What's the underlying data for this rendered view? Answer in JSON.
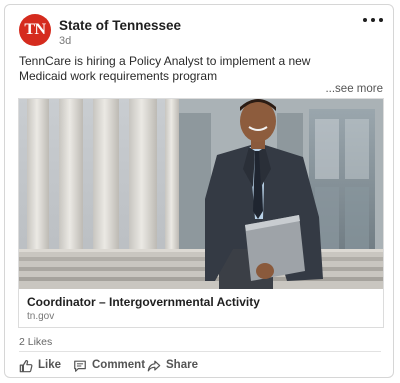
{
  "post": {
    "author": "State of Tennessee",
    "avatar_text": "TN",
    "timestamp": "3d",
    "text": "TennCare is hiring a Policy Analyst to implement a new Medicaid work requirements program",
    "see_more": "...see more"
  },
  "link_preview": {
    "title": "Coordinator – Intergovernmental Activity",
    "domain": "tn.gov"
  },
  "engagement": {
    "likes": "2 Likes"
  },
  "actions": {
    "like": "Like",
    "comment": "Comment",
    "share": "Share"
  },
  "colors": {
    "brand_red": "#d52b1e",
    "icon": "#555555"
  },
  "icons": {
    "more": "more-options-icon",
    "like": "thumbs-up-icon",
    "comment": "comment-icon",
    "share": "share-icon"
  }
}
